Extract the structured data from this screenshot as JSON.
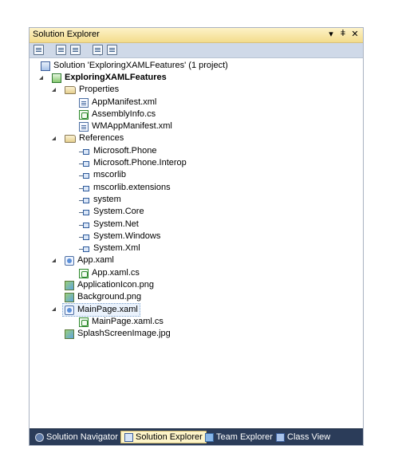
{
  "window": {
    "title": "Solution Explorer",
    "controls": {
      "dropdown": "▾",
      "pin": "ǂ",
      "close": "✕"
    }
  },
  "toolbar": {
    "buttons": [
      {
        "icon": "properties-icon"
      },
      {
        "icon": "show-all-files-icon"
      },
      {
        "icon": "refresh-icon"
      },
      {
        "icon": "view-code-icon"
      },
      {
        "icon": "view-designer-icon"
      }
    ]
  },
  "tree": {
    "solution": "Solution 'ExploringXAMLFeatures' (1 project)",
    "project": "ExploringXAMLFeatures",
    "properties": {
      "label": "Properties",
      "items": [
        "AppManifest.xml",
        "AssemblyInfo.cs",
        "WMAppManifest.xml"
      ]
    },
    "references": {
      "label": "References",
      "items": [
        "Microsoft.Phone",
        "Microsoft.Phone.Interop",
        "mscorlib",
        "mscorlib.extensions",
        "system",
        "System.Core",
        "System.Net",
        "System.Windows",
        "System.Xml"
      ]
    },
    "app_xaml": {
      "label": "App.xaml",
      "child": "App.xaml.cs"
    },
    "application_icon": "ApplicationIcon.png",
    "background": "Background.png",
    "mainpage_xaml": {
      "label": "MainPage.xaml",
      "child": "MainPage.xaml.cs"
    },
    "splash": "SplashScreenImage.jpg"
  },
  "bottom_tabs": [
    {
      "label": "Solution Navigator",
      "active": false
    },
    {
      "label": "Solution Explorer",
      "active": true
    },
    {
      "label": "Team Explorer",
      "active": false
    },
    {
      "label": "Class View",
      "active": false
    }
  ],
  "colors": {
    "titlebar": "#f3dc8c",
    "toolbar": "#cfd9e8",
    "bottombar": "#2b3c59",
    "active_tab": "#fdf4c9"
  }
}
